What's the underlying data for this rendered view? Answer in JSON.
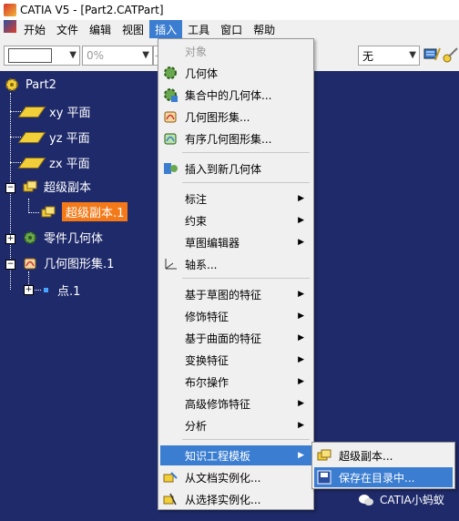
{
  "window": {
    "title": "CATIA V5 - [Part2.CATPart]"
  },
  "menubar": {
    "items": [
      "开始",
      "文件",
      "编辑",
      "视图",
      "插入",
      "工具",
      "窗口",
      "帮助"
    ],
    "active": "插入"
  },
  "toolbar": {
    "percent_value": "0%",
    "dash": "-",
    "right_combo_value": "无"
  },
  "tree": {
    "root": "Part2",
    "nodes": [
      "xy 平面",
      "yz 平面",
      "zx 平面",
      "超级副本",
      "超级副本.1",
      "零件几何体",
      "几何图形集.1",
      "点.1"
    ],
    "selected": "超级副本.1"
  },
  "insert_menu": {
    "items": [
      {
        "label": "对象",
        "icon": "object-icon",
        "disabled": true
      },
      {
        "label": "几何体",
        "icon": "body-icon"
      },
      {
        "label": "集合中的几何体...",
        "icon": "body-in-set-icon"
      },
      {
        "label": "几何图形集...",
        "icon": "geometrical-set-icon"
      },
      {
        "label": "有序几何图形集...",
        "icon": "ordered-geometrical-set-icon"
      },
      {
        "label": "插入到新几何体",
        "icon": "insert-new-body-icon"
      },
      {
        "label": "标注",
        "submenu": true
      },
      {
        "label": "约束",
        "submenu": true
      },
      {
        "label": "草图编辑器",
        "submenu": true
      },
      {
        "label": "轴系...",
        "icon": "axis-system-icon"
      },
      {
        "label": "基于草图的特征",
        "submenu": true
      },
      {
        "label": "修饰特征",
        "submenu": true
      },
      {
        "label": "基于曲面的特征",
        "submenu": true
      },
      {
        "label": "变换特征",
        "submenu": true
      },
      {
        "label": "布尔操作",
        "submenu": true
      },
      {
        "label": "高级修饰特征",
        "submenu": true
      },
      {
        "label": "分析",
        "submenu": true
      },
      {
        "label": "知识工程模板",
        "submenu": true,
        "highlighted": true
      },
      {
        "label": "从文档实例化...",
        "icon": "instantiate-from-document-icon"
      },
      {
        "label": "从选择实例化...",
        "icon": "instantiate-from-selection-icon"
      }
    ]
  },
  "kw_submenu": {
    "items": [
      {
        "label": "超级副本...",
        "icon": "powercopy-icon"
      },
      {
        "label": "保存在目录中...",
        "icon": "save-in-catalog-icon",
        "highlighted": true
      }
    ]
  },
  "watermark": {
    "text": "CATIA小蚂蚁"
  },
  "colors": {
    "tree_bg": "#1f2a6a",
    "highlight": "#3a7dd1",
    "selection": "#f47a19",
    "menu_bg": "#f0f0f0"
  }
}
